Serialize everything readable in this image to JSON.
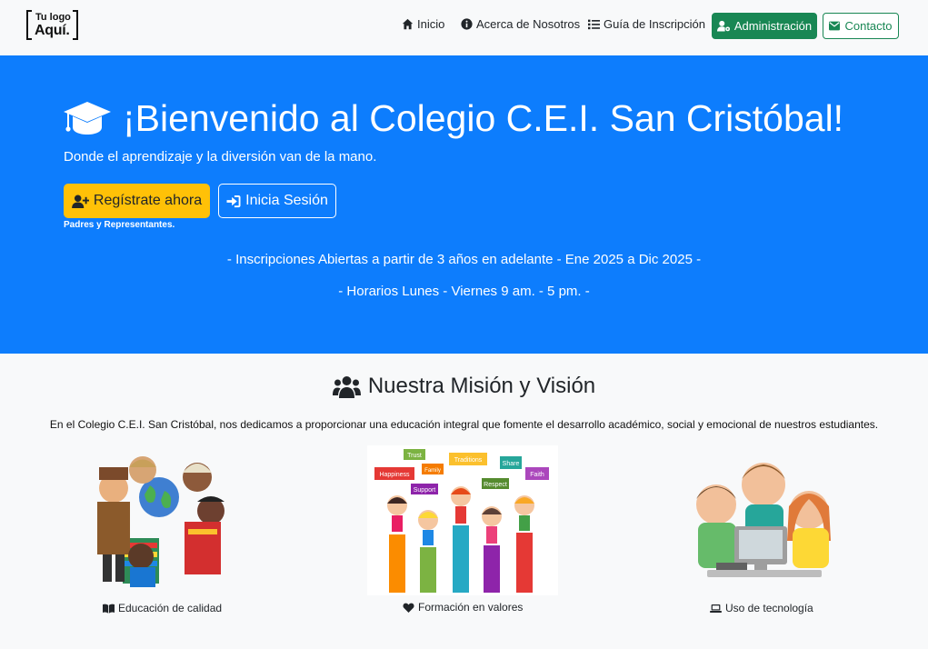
{
  "navbar": {
    "logo_line1": "Tu logo",
    "logo_line2": "Aquí.",
    "links": [
      {
        "label": "Inicio",
        "icon": "home-icon"
      },
      {
        "label": "Acerca de Nosotros",
        "icon": "info-circle-icon"
      },
      {
        "label": "Guía de Inscripción",
        "icon": "list-icon"
      }
    ],
    "admin_label": "Administración",
    "contact_label": "Contacto"
  },
  "hero": {
    "title": "¡Bienvenido al Colegio C.E.I. San Cristóbal!",
    "subtitle": "Donde el aprendizaje y la diversión van de la mano.",
    "register_label": "Regístrate ahora",
    "login_label": "Inicia Sesión",
    "parents_note": "Padres y Representantes.",
    "line1": "- Inscripciones Abiertas a partir de 3 años en adelante - Ene 2025 a Dic 2025 -",
    "line2": "- Horarios Lunes - Viernes 9 am. - 5 pm. -",
    "background_color": "#0d7dfd"
  },
  "mission": {
    "title": "Nuestra Misión y Visión",
    "text": "En el Colegio C.E.I. San Cristóbal, nos dedicamos a proporcionar una educación integral que fomente el desarrollo académico, social y emocional de nuestros estudiantes.",
    "features": [
      {
        "label": "Educación de calidad",
        "icon": "book-open-icon"
      },
      {
        "label": "Formación en valores",
        "icon": "heart-icon"
      },
      {
        "label": "Uso de tecnología",
        "icon": "laptop-icon"
      }
    ],
    "values_words": [
      "Trust",
      "Traditions",
      "Happiness",
      "Family",
      "Share",
      "Respect",
      "Faith",
      "Support"
    ]
  },
  "colors": {
    "success": "#198754",
    "warning": "#ffc107",
    "primary": "#0d7dfd"
  }
}
